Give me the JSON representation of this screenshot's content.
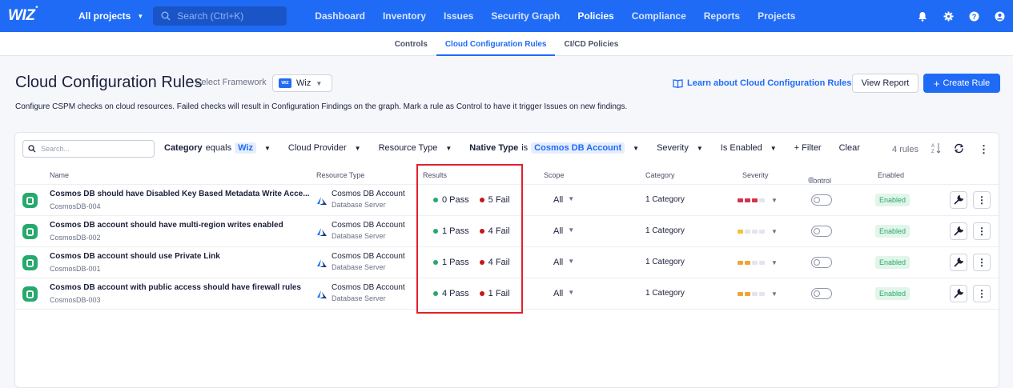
{
  "nav": {
    "logo": "WIZ",
    "logo_mark": "*",
    "project": "All projects",
    "search_placeholder": "Search (Ctrl+K)",
    "links": [
      "Dashboard",
      "Inventory",
      "Issues",
      "Security Graph",
      "Policies",
      "Compliance",
      "Reports",
      "Projects"
    ],
    "active_link": "Policies"
  },
  "subtabs": [
    "Controls",
    "Cloud Configuration Rules",
    "CI/CD Policies"
  ],
  "header": {
    "title": "Cloud Configuration Rules",
    "select_framework": "Select Framework",
    "framework": "Wiz",
    "learn": "Learn about Cloud Configuration Rules",
    "view_report": "View Report",
    "create_rule": "Create Rule",
    "description": "Configure CSPM checks on cloud resources. Failed checks will result in Configuration Findings on the graph. Mark a rule as Control to have it trigger Issues on new findings."
  },
  "filters": {
    "search_placeholder": "Search...",
    "category_label": "Category",
    "category_op": "equals",
    "category_value": "Wiz",
    "cloud_provider": "Cloud Provider",
    "resource_type": "Resource Type",
    "native_label": "Native Type",
    "native_op": "is",
    "native_value": "Cosmos DB Account",
    "severity": "Severity",
    "is_enabled": "Is Enabled",
    "add_filter": "+ Filter",
    "clear": "Clear",
    "count": "4 rules"
  },
  "columns": [
    "Name",
    "Resource Type",
    "Results",
    "Scope",
    "Category",
    "Severity",
    "Control",
    "Enabled"
  ],
  "rows": [
    {
      "name": "Cosmos DB should have Disabled Key Based Metadata Write Acce...",
      "id": "CosmosDB-004",
      "type": "Cosmos DB Account",
      "subtype": "Database Server",
      "pass": "0 Pass",
      "fail": "5 Fail",
      "scope": "All",
      "category": "1 Category",
      "severity": "high",
      "enabled": "Enabled"
    },
    {
      "name": "Cosmos DB account should have multi-region writes enabled",
      "id": "CosmosDB-002",
      "type": "Cosmos DB Account",
      "subtype": "Database Server",
      "pass": "1 Pass",
      "fail": "4 Fail",
      "scope": "All",
      "category": "1 Category",
      "severity": "low",
      "enabled": "Enabled"
    },
    {
      "name": "Cosmos DB account should use Private Link",
      "id": "CosmosDB-001",
      "type": "Cosmos DB Account",
      "subtype": "Database Server",
      "pass": "1 Pass",
      "fail": "4 Fail",
      "scope": "All",
      "category": "1 Category",
      "severity": "medium",
      "enabled": "Enabled"
    },
    {
      "name": "Cosmos DB account with public access should have firewall rules",
      "id": "CosmosDB-003",
      "type": "Cosmos DB Account",
      "subtype": "Database Server",
      "pass": "4 Pass",
      "fail": "1 Fail",
      "scope": "All",
      "category": "1 Category",
      "severity": "medium",
      "enabled": "Enabled"
    }
  ],
  "colors": {
    "primary": "#1f6bf5",
    "pass": "#26a96c",
    "fail": "#c4161c",
    "high": "#d1344a",
    "medium": "#f0a33a",
    "low": "#f2c230",
    "highlight": "#e3202d"
  }
}
